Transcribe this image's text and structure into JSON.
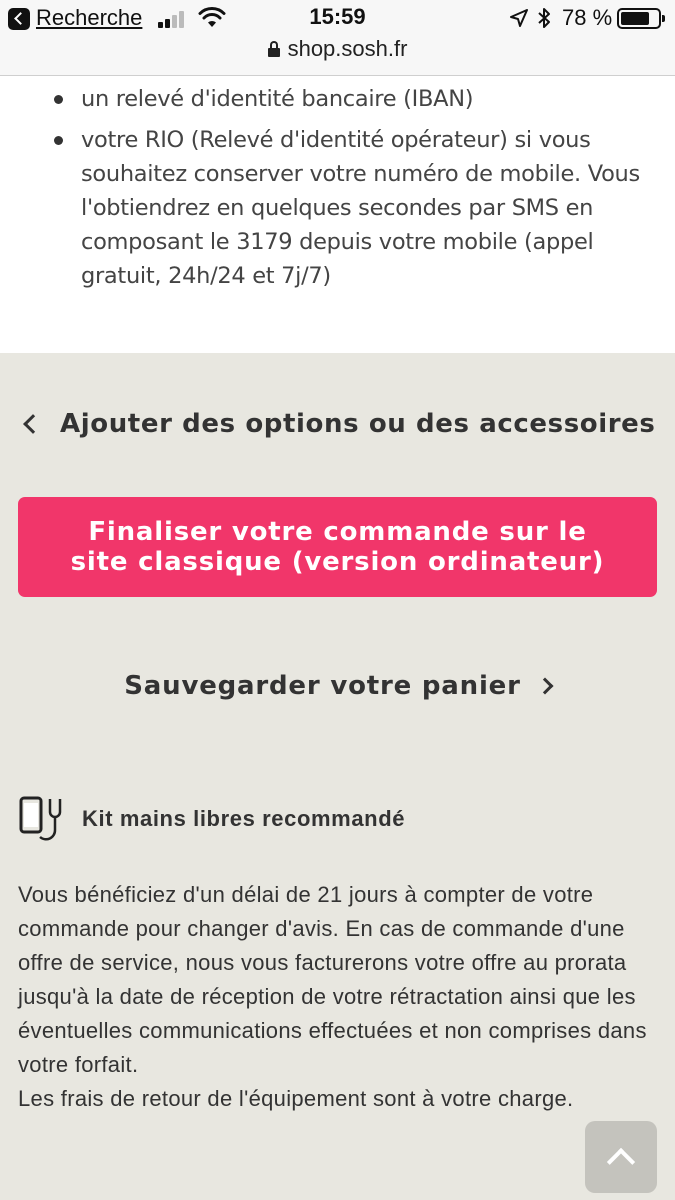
{
  "status_bar": {
    "back_label": "Recherche",
    "time": "15:59",
    "battery_percent": "78 %",
    "battery_level": 0.78,
    "url": "shop.sosh.fr"
  },
  "documents": {
    "items": [
      "un relevé d'identité bancaire (IBAN)",
      "votre RIO (Relevé d'identité opérateur) si vous souhaitez conserver votre numéro de mobile. Vous l'obtiendrez en quelques secondes par SMS en composant le 3179 depuis votre mobile (appel gratuit, 24h/24 et 7j/7)"
    ]
  },
  "actions": {
    "back_link": "Ajouter des options ou des accessoires",
    "cta": "Finaliser votre commande sur le site classique (version ordinateur)",
    "save_link": "Sauvegarder votre panier"
  },
  "kit": {
    "label": "Kit mains libres recommandé",
    "icon": "phone-headset-icon"
  },
  "legal": {
    "paragraph1": "Vous bénéficiez d'un délai de 21 jours à compter de votre commande pour changer d'avis. En cas de commande d'une offre de service, nous vous facturerons votre offre au prorata jusqu'à la date de réception de votre rétractation ainsi que les éventuelles communications effectuées et non comprises dans votre forfait.",
    "paragraph2": "Les frais de retour de l'équipement sont à votre charge."
  },
  "colors": {
    "cta": "#f1366a",
    "background": "#e8e7e0",
    "text": "#333333"
  }
}
